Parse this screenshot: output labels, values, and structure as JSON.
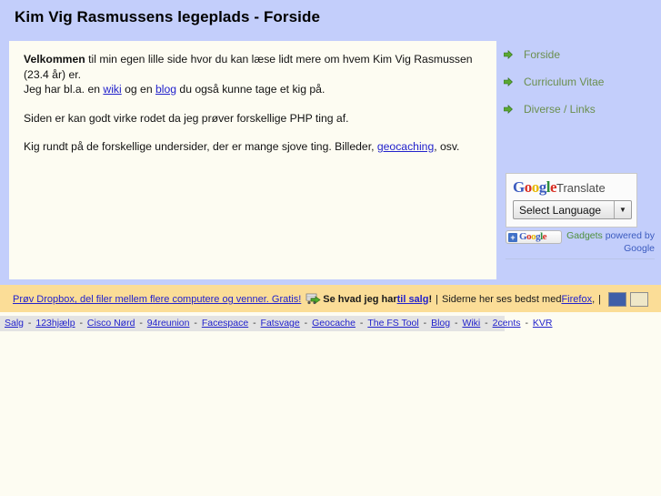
{
  "header": {
    "title": "Kim Vig Rasmussens legeplads - Forside"
  },
  "colors": {
    "header_bg": "#c3cefb",
    "content_bg": "#fdfcf2",
    "footer_bar_bg": "#fbdd97",
    "bottom_links_bg": "#e3e3e3",
    "link": "#2222cc",
    "nav_label": "#6b8f4e"
  },
  "content": {
    "para1_bold": "Velkommen",
    "para1_rest": " til min egen lille side hvor du kan læse lidt mere om hvem Kim Vig Rasmussen (23.4 år) er.",
    "para2_pre": "Jeg har bl.a. en ",
    "para2_link1": "wiki",
    "para2_mid": " og en ",
    "para2_link2": "blog",
    "para2_post": " du også kunne tage et kig på.",
    "para3": "Siden er kan godt virke rodet da jeg prøver forskellige PHP ting af.",
    "para4_pre": "Kig rundt på de forskellige undersider, der er mange sjove ting. Billeder, ",
    "para4_link": "geocaching",
    "para4_post": ", osv."
  },
  "sidebar": {
    "items": [
      {
        "label": "Forside",
        "icon": "green-arrow-icon"
      },
      {
        "label": "Curriculum Vitae",
        "icon": "green-arrow-icon"
      },
      {
        "label": "Diverse / Links",
        "icon": "green-arrow-icon"
      }
    ]
  },
  "translate_gadget": {
    "logo_letters": [
      "G",
      "o",
      "o",
      "g",
      "l",
      "e"
    ],
    "title_word": "Translate",
    "select_value": "Select Language",
    "select_options": [
      "Select Language"
    ],
    "dropdown_arrow": "▼"
  },
  "gadget_footer": {
    "badge_label": "Google",
    "badge_plus": "+",
    "credit_line1": "Gadgets",
    "credit_line1b": " powered by",
    "credit_line2": "Google"
  },
  "footer_bar": {
    "dropbox_link": "Prøv Dropbox, del filer mellem flere computere og venner. Gratis!",
    "cart_icon": "cart-arrow-icon",
    "salg_pre": "Se hvad jeg har ",
    "salg_link": "til salg",
    "salg_post": "!",
    "separator1": "|",
    "firefox_pre": "Siderne her ses bedst med ",
    "firefox_link": "Firefox",
    "firefox_post": ",",
    "separator2": "|",
    "badge_html": "html-validator-badge",
    "badge_css": "css-validator-badge"
  },
  "bottom_links": {
    "separator": "-",
    "items": [
      "Salg",
      "123hjælp",
      "Cisco Nørd",
      "94reunion",
      "Facespace",
      "Fatsvage",
      "Geocache",
      "The FS Tool",
      "Blog",
      "Wiki",
      "2cents",
      "KVR"
    ]
  }
}
